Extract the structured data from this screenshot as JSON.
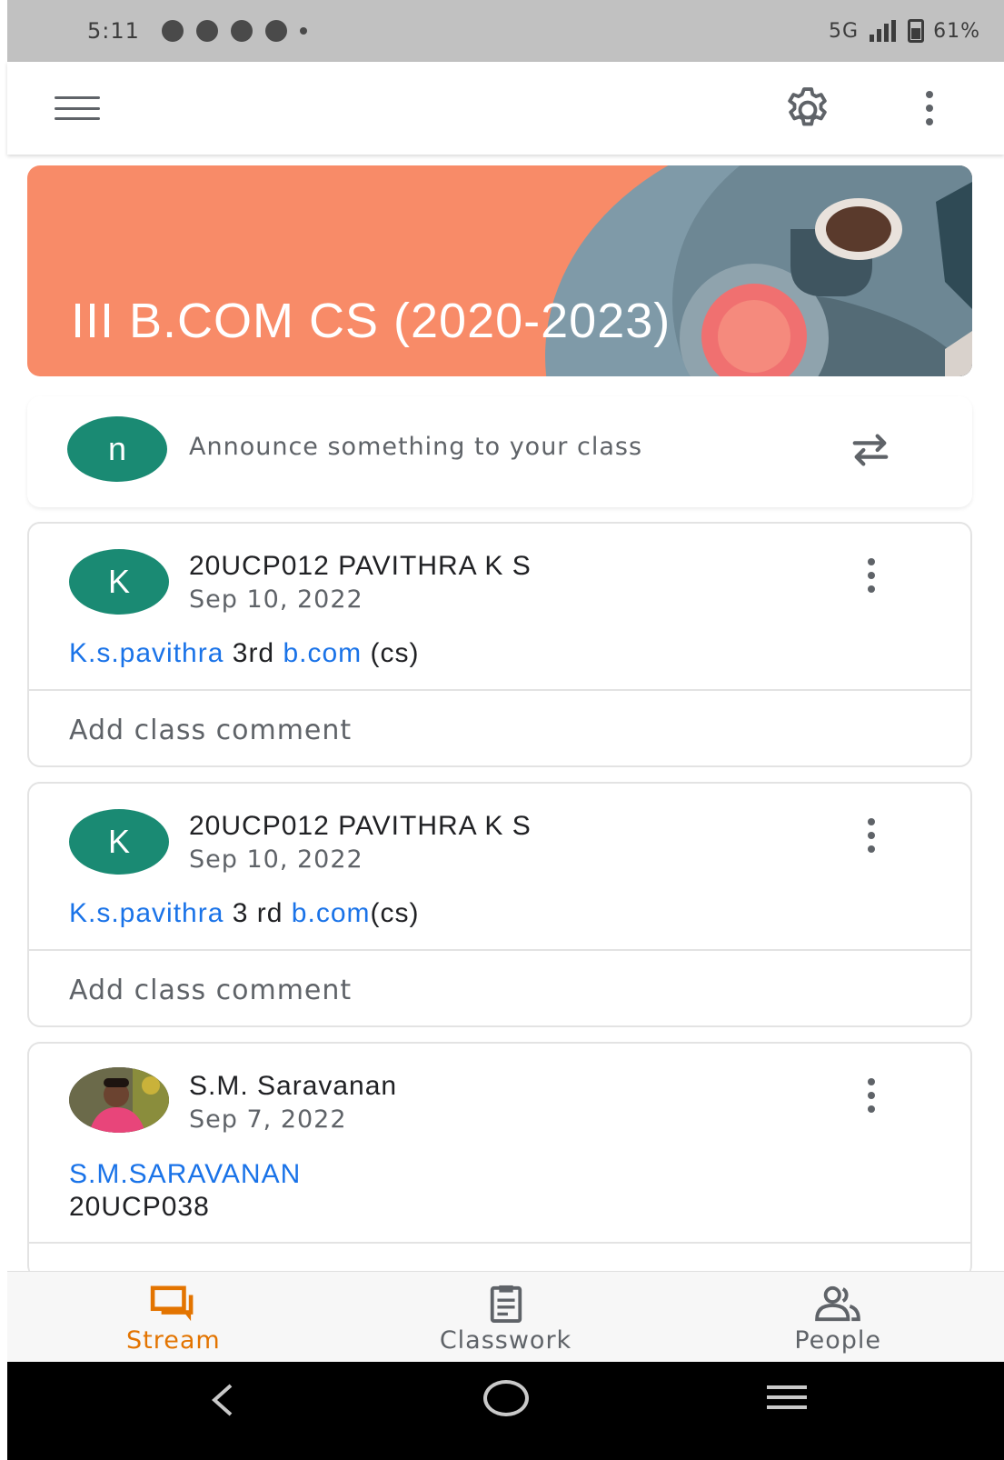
{
  "status_bar": {
    "time": "5:11",
    "network": "5G",
    "battery": "61%"
  },
  "banner": {
    "class_title": "III B.COM CS (2020-2023)",
    "color": "#f88b68"
  },
  "announce": {
    "avatar_letter": "n",
    "placeholder": "Announce something to your class"
  },
  "posts": [
    {
      "avatar_letter": "K",
      "author": "20UCP012 PAVITHRA K S",
      "date": "Sep 10, 2022",
      "body_parts": [
        "K.s.pavithra",
        " 3rd ",
        "b.com",
        " (cs)"
      ],
      "comment_placeholder": "Add class comment"
    },
    {
      "avatar_letter": "K",
      "author": "20UCP012 PAVITHRA K S",
      "date": "Sep 10, 2022",
      "body_parts": [
        "K.s.pavithra",
        " 3 rd ",
        "b.com",
        "(cs)"
      ],
      "comment_placeholder": "Add class comment"
    },
    {
      "author": "S.M. Saravanan",
      "date": "Sep 7, 2022",
      "body_line1": "S.M.SARAVANAN",
      "body_line2": "20UCP038"
    }
  ],
  "bottom_nav": {
    "stream": "Stream",
    "classwork": "Classwork",
    "people": "People",
    "active": "stream"
  },
  "colors": {
    "accent_teal": "#1a8a73",
    "link_blue": "#1a73e8",
    "active_orange": "#e37400"
  },
  "icons": [
    "menu-icon",
    "gear-icon",
    "more-vert-icon",
    "repost-icon",
    "stream-icon",
    "classwork-icon",
    "people-icon"
  ]
}
